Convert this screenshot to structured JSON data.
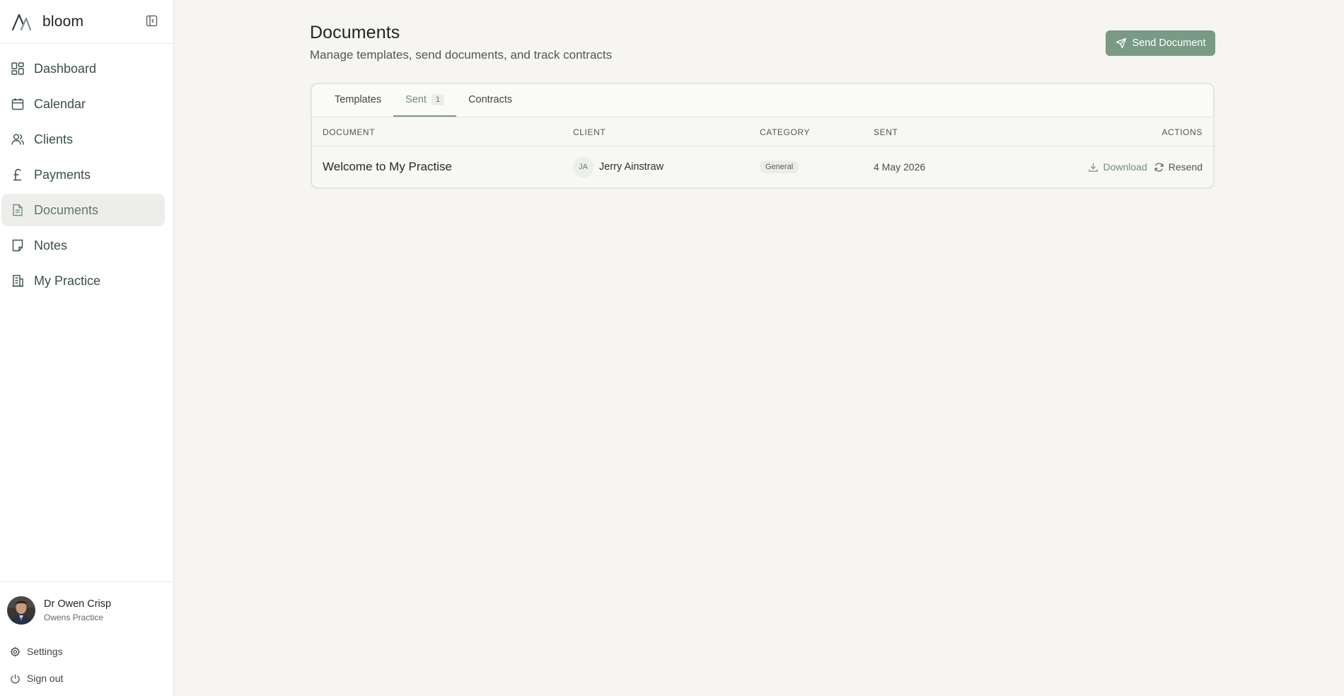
{
  "brand": {
    "name": "bloom"
  },
  "sidebar": {
    "items": [
      {
        "label": "Dashboard",
        "icon": "dashboard-grid-icon"
      },
      {
        "label": "Calendar",
        "icon": "calendar-icon"
      },
      {
        "label": "Clients",
        "icon": "users-icon"
      },
      {
        "label": "Payments",
        "icon": "pound-icon"
      },
      {
        "label": "Documents",
        "icon": "document-icon",
        "active": true
      },
      {
        "label": "Notes",
        "icon": "note-icon"
      },
      {
        "label": "My Practice",
        "icon": "building-icon"
      }
    ]
  },
  "user": {
    "name": "Dr Owen Crisp",
    "practice": "Owens Practice",
    "settings_label": "Settings",
    "signout_label": "Sign out"
  },
  "page": {
    "title": "Documents",
    "subtitle": "Manage templates, send documents, and track contracts",
    "send_button": "Send Document"
  },
  "tabs": [
    {
      "label": "Templates"
    },
    {
      "label": "Sent",
      "count": "1",
      "active": true
    },
    {
      "label": "Contracts"
    }
  ],
  "table": {
    "columns": [
      "DOCUMENT",
      "CLIENT",
      "CATEGORY",
      "SENT",
      "ACTIONS"
    ],
    "rows": [
      {
        "document": "Welcome to My Practise",
        "client_initials": "JA",
        "client": "Jerry Ainstraw",
        "category": "General",
        "sent": "4 May 2026",
        "actions": [
          "Download",
          "Resend"
        ]
      }
    ]
  },
  "colors": {
    "accent": "#7a9a86",
    "background": "#f6f5f2",
    "sidebar_active": "#edeeec"
  }
}
